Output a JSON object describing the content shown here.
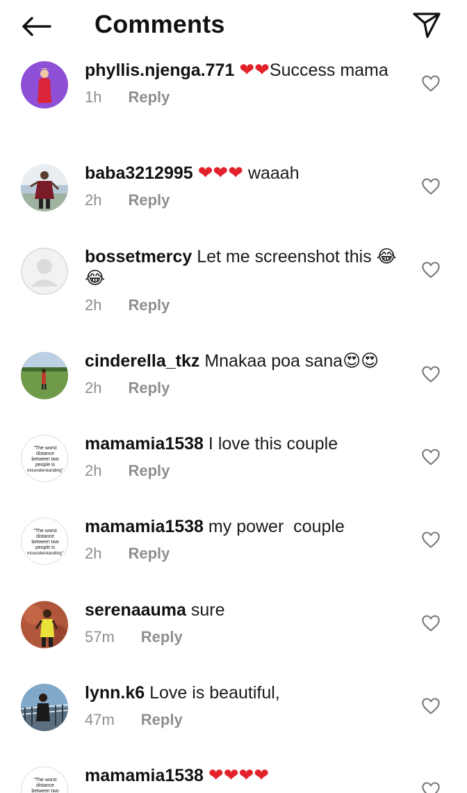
{
  "header": {
    "title": "Comments",
    "back_icon": "arrow-left-icon",
    "send_icon": "paper-plane-icon"
  },
  "reply_label": "Reply",
  "comments": [
    {
      "username": "phyllis.njenga.771",
      "text": "❤️❤️Success mama",
      "emoji_prefix": "❤❤",
      "body": "Success mama",
      "time": "1h",
      "avatar": "purple"
    },
    {
      "username": "baba3212995",
      "emoji_prefix": "❤❤❤",
      "body": " waaah",
      "time": "2h",
      "avatar": "outdoor"
    },
    {
      "username": "bossetmercy",
      "body": "Let me screenshot this 😂😂",
      "time": "2h",
      "avatar": "default"
    },
    {
      "username": "cinderella_tkz",
      "body": "Mnakaa poa sana😍😍",
      "time": "2h",
      "avatar": "field"
    },
    {
      "username": "mamamia1538",
      "body": "I love this couple",
      "time": "2h",
      "avatar": "quote"
    },
    {
      "username": "mamamia1538",
      "body": "my power  couple",
      "time": "2h",
      "avatar": "quote"
    },
    {
      "username": "serenaauma",
      "body": "sure",
      "time": "57m",
      "avatar": "athlete"
    },
    {
      "username": "lynn.k6",
      "body": "Love is beautiful,",
      "time": "47m",
      "avatar": "rail"
    },
    {
      "username": "mamamia1538",
      "emoji_prefix": "❤❤❤❤",
      "body": "",
      "time": "",
      "avatar": "quote"
    }
  ],
  "quote_avatar_text": [
    "\"The worst",
    "distance",
    "between two",
    "people is",
    "misunderstanding\""
  ],
  "colors": {
    "heart": "#e3212b",
    "meta": "#8e8e8e",
    "avatar_purple": "#8e4fd6"
  }
}
